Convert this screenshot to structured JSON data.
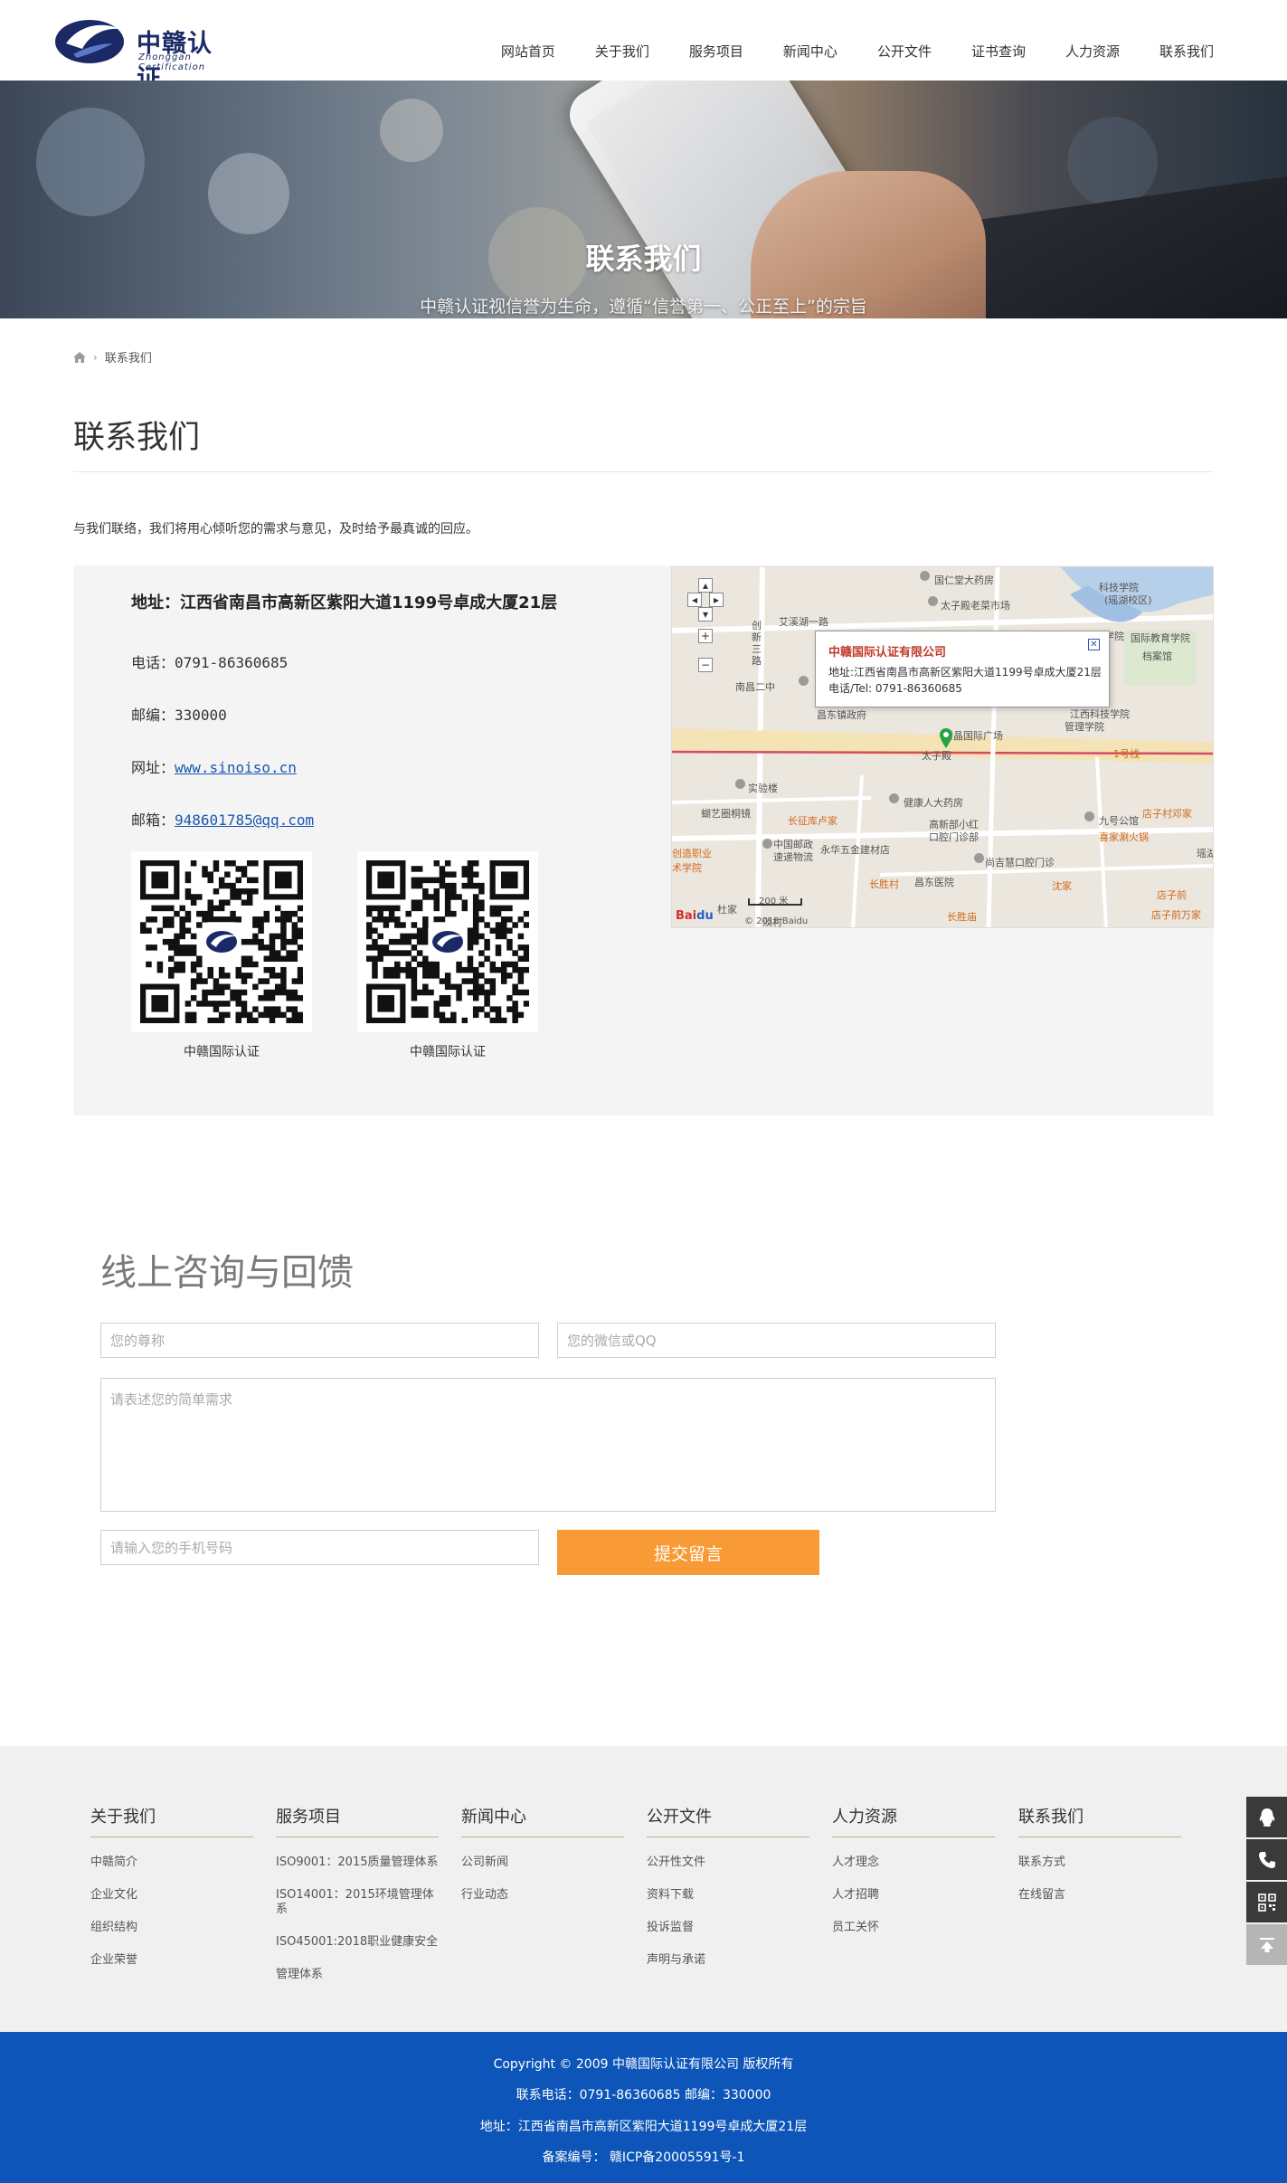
{
  "header": {
    "logo_cn": "中赣认证",
    "logo_en": "Zhonggan Certification",
    "nav": [
      "网站首页",
      "关于我们",
      "服务项目",
      "新闻中心",
      "公开文件",
      "证书查询",
      "人力资源",
      "联系我们"
    ]
  },
  "banner": {
    "title": "联系我们",
    "subtitle": "中赣认证视信誉为生命，遵循“信誉第一、公正至上”的宗旨"
  },
  "breadcrumb": {
    "current": "联系我们"
  },
  "page": {
    "title": "联系我们",
    "intro": "与我们联络，我们将用心倾听您的需求与意见，及时给予最真诚的回应。"
  },
  "contact": {
    "address": "地址：江西省南昌市高新区紫阳大道1199号卓成大厦21层",
    "phone_label": "电话：",
    "phone": "0791-86360685",
    "zip_label": "邮编：",
    "zip": "330000",
    "web_label": "网址：",
    "web": "www.sinoiso.cn",
    "email_label": "邮箱：",
    "email": "948601785@qq.com",
    "qr": [
      {
        "caption": "中赣国际认证"
      },
      {
        "caption": "中赣国际认证"
      }
    ]
  },
  "map": {
    "popup_title": "中赣国际认证有限公司",
    "popup_address": "地址:江西省南昌市高新区紫阳大道1199号卓成大厦21层",
    "popup_phone": "电话/Tel: 0791-86360685",
    "labels": {
      "l1": "国仁堂大药房",
      "l2": "科技学院",
      "l3": "(瑶湖校区)",
      "l4": "太子殿老菜市场",
      "l5": "艾溪湖一路",
      "l6": "创新三路",
      "l7": "南昌二中",
      "l8": "昌东镇政府",
      "l9": "紫晶国际广场",
      "l10": "江西科技学院",
      "l11": "国际教育学院",
      "l12": "江西科技学院",
      "l13": "管理学院",
      "l14": "太子殿",
      "l15": "1号线",
      "l16": "实验楼",
      "l17": "长征库卢家",
      "l18": "健康人大药房",
      "l19": "蝴艺圈桐镜",
      "l20": "九号公馆",
      "l21": "店子村邓家",
      "l22": "中国邮政",
      "l23": "速递物流",
      "l24": "永华五金建材店",
      "l25": "高新部小红",
      "l26": "口腔门诊部",
      "l27": "喜家涮火锅",
      "l28": "尚吉慧口腔门诊",
      "l29": "瑶湖",
      "l30": "长胜村",
      "l31": "昌东医院",
      "l32": "沈家",
      "l33": "店子前",
      "l34": "店子前万家",
      "l35": "长胜庙",
      "l36": "创造职业",
      "l37": "术学院",
      "l38": "杜家",
      "l39": "淡村",
      "l40": "档案馆",
      "scale": "200 米",
      "copyright": "© 2018 Baidu"
    }
  },
  "feedback": {
    "title": "线上咨询与回馈",
    "name_placeholder": "您的尊称",
    "wechat_placeholder": "您的微信或QQ",
    "message_placeholder": "请表述您的简单需求",
    "mobile_placeholder": "请输入您的手机号码",
    "submit": "提交留言"
  },
  "footer": {
    "columns": [
      {
        "title": "关于我们",
        "links": [
          "中赣简介",
          "企业文化",
          "组织结构",
          "企业荣誉"
        ]
      },
      {
        "title": "服务项目",
        "links": [
          "ISO9001：2015质量管理体系",
          "ISO14001：2015环境管理体系",
          "ISO45001:2018职业健康安全",
          "管理体系"
        ]
      },
      {
        "title": "新闻中心",
        "links": [
          "公司新闻",
          "行业动态"
        ]
      },
      {
        "title": "公开文件",
        "links": [
          "公开性文件",
          "资料下载",
          "投诉监督",
          "声明与承诺"
        ]
      },
      {
        "title": "人力资源",
        "links": [
          "人才理念",
          "人才招聘",
          "员工关怀"
        ]
      },
      {
        "title": "联系我们",
        "links": [
          "联系方式",
          "在线留言"
        ]
      }
    ],
    "copyright": "Copyright © 2009 中赣国际认证有限公司 版权所有",
    "contact_line": "联系电话：0791-86360685 邮编：330000",
    "address_line": "地址：江西省南昌市高新区紫阳大道1199号卓成大厦21层",
    "icp_line": "备案编号：  赣ICP备20005591号-1"
  },
  "side_tools": [
    "qq-icon",
    "phone-icon",
    "qrcode-icon",
    "back-to-top-icon"
  ],
  "colors": {
    "accent": "#f89a36",
    "footer_bar": "#0d55b8",
    "brand": "#1b2a66",
    "link": "#1a56b4"
  }
}
